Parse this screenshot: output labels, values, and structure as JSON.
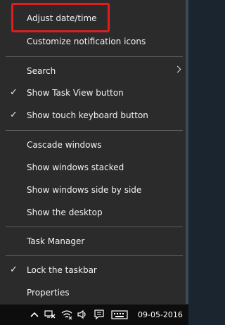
{
  "context_menu": {
    "items": {
      "adjust_datetime": "Adjust date/time",
      "customize_notification_icons": "Customize notification icons",
      "search": "Search",
      "show_task_view": "Show Task View button",
      "show_touch_keyboard": "Show touch keyboard button",
      "cascade_windows": "Cascade windows",
      "show_windows_stacked": "Show windows stacked",
      "show_windows_side_by_side": "Show windows side by side",
      "show_desktop": "Show the desktop",
      "task_manager": "Task Manager",
      "lock_taskbar": "Lock the taskbar",
      "properties": "Properties"
    },
    "checked": {
      "show_task_view": true,
      "show_touch_keyboard": true,
      "lock_taskbar": true
    },
    "check_glyph": "✓",
    "highlight_color": "#e01e1e"
  },
  "taskbar": {
    "clock_date": "09-05-2016",
    "tray_icons": [
      "chevron-up-icon",
      "network-disconnected-icon",
      "wifi-icon",
      "volume-icon",
      "action-center-icon",
      "keyboard-icon"
    ]
  }
}
